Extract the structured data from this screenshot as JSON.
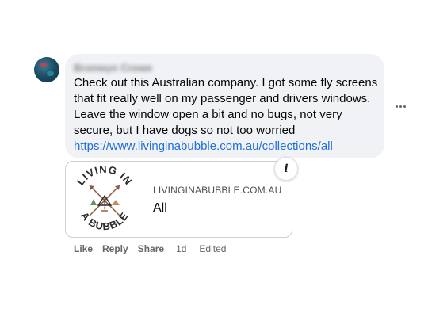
{
  "comment": {
    "author": "Bronwyn Crowe",
    "text": "Check out this Australian company. I got some fly screens that fit really well on my passenger and drivers windows. Leave the window open a bit and no bugs, not very secure, but I have dogs so not too worried",
    "link_text": "https://www.livinginabubble.com.au/collections/all"
  },
  "link_preview": {
    "domain": "LIVINGINABUBBLE.COM.AU",
    "title": "All",
    "logo_text_top": "LIVING IN",
    "logo_text_bottom": "A BUBBLE",
    "info_glyph": "i"
  },
  "actions": {
    "like": "Like",
    "reply": "Reply",
    "share": "Share",
    "time": "1d",
    "edited": "Edited"
  },
  "icons": {
    "more": "more-horizontal-icon",
    "info": "info-icon"
  },
  "colors": {
    "bubble_bg": "#f0f2f5",
    "link": "#216fdb",
    "meta": "#65676b"
  }
}
